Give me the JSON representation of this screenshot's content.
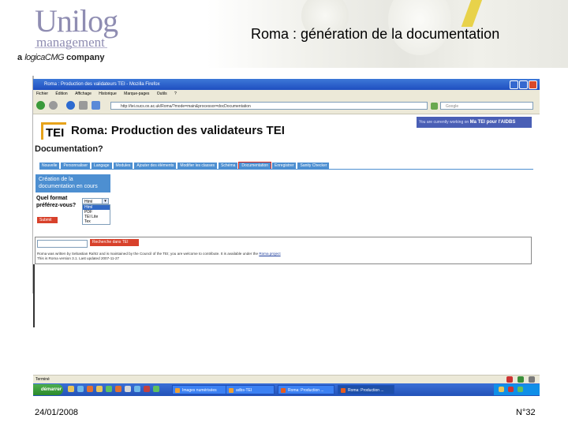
{
  "slide": {
    "logo_main": "Unilog",
    "logo_sub": "management",
    "tagline_prefix": "a ",
    "tagline_brand": "logicaCMG",
    "tagline_suffix": " company",
    "title": "Roma : génération de la documentation",
    "date": "24/01/2008",
    "page_number": "N°32"
  },
  "browser": {
    "window_title": "Roma : Production des validateurs TEI - Mozilla Firefox",
    "menu": [
      "Fichier",
      "Édition",
      "Affichage",
      "Historique",
      "Marque-pages",
      "Outils",
      "?"
    ],
    "url": "http://tei.oucs.ox.ac.uk/Roma/?mode=main&processor=docDocumentation",
    "search_placeholder": "Google",
    "page": {
      "tei_logo": "TEI",
      "heading": "Roma: Production des validateurs TEI",
      "working_prefix": "You are currently working on",
      "working_project": "Ma TEI pour l'AIDBS",
      "section_title": "Documentation?",
      "tabs": [
        "Nouvelle",
        "Personnaliser",
        "Langage",
        "Modules",
        "Ajouter des éléments",
        "Modifier les classes",
        "Schéma",
        "Documentation",
        "Enregistrer",
        "Sanity Checker"
      ],
      "active_tab_index": 7,
      "panel_text": "Création de la documentation en cours",
      "format_label": "Quel format préférez-vous?",
      "format_selected": "Html",
      "format_options": [
        "Html",
        "PDF",
        "TEI Lite",
        "Tex"
      ],
      "format_highlight_index": 0,
      "submit_label": "Submit",
      "search_button": "Recherche dans TEI",
      "info_line1_before": "Roma was written by Sebastian Rahtz and is maintained by the Council of the TEI; you are welcome to contribute. It is available under the ",
      "info_line1_link": "Roma project",
      "info_line2": "This is Roma version 3.1. Last updated 2007-11-27"
    },
    "status_text": "Terminé",
    "taskbar": {
      "start_label": "démarrer",
      "tasks": [
        "Images numérisées",
        "adbs-TEI",
        "Roma: Production ...",
        "Roma: Production ..."
      ],
      "active_task_index": 3
    }
  },
  "colors": {
    "logo_purple": "#8f8db2",
    "tab_blue": "#4d8fd1",
    "button_red": "#d8412b",
    "tei_orange": "#e7a31a"
  }
}
